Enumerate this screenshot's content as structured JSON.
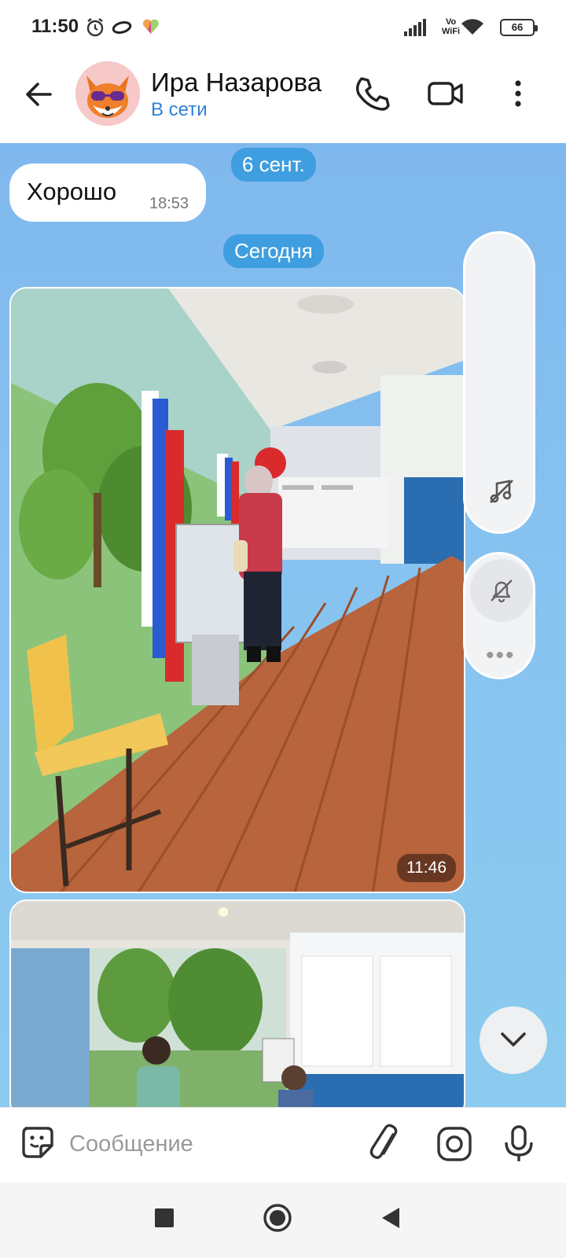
{
  "status_bar": {
    "time": "11:50",
    "volte_label": "Vo\nWiFi",
    "battery": "66",
    "icons": [
      "alarm-icon",
      "link-icon",
      "app-heart-icon",
      "signal-icon",
      "wifi-icon",
      "battery-icon"
    ]
  },
  "header": {
    "contact_name": "Ира Назарова",
    "presence": "В сети",
    "icons": [
      "back-arrow-icon",
      "phone-icon",
      "video-camera-icon",
      "more-vertical-icon"
    ]
  },
  "chat": {
    "date_separator_1": "6 сент.",
    "message_1": {
      "text": "Хорошо",
      "time": "18:53"
    },
    "date_separator_2": "Сегодня",
    "photo_1": {
      "time": "11:46",
      "description_icon": "photo"
    },
    "photo_2": {
      "time": ""
    },
    "side_panel_icons": [
      "music-off-icon",
      "bell-off-icon",
      "more-horizontal-icon"
    ],
    "dots_label": "•••"
  },
  "input": {
    "placeholder": "Сообщение",
    "icons": [
      "emoji-sticker-icon",
      "attach-paperclip-icon",
      "camera-icon",
      "microphone-icon"
    ]
  },
  "nav": {
    "icons": [
      "recent-apps-square-icon",
      "home-circle-icon",
      "back-triangle-icon"
    ]
  },
  "colors": {
    "accent": "#2f83d6",
    "date_pill": "#3f9ee0",
    "chat_bg_top": "#7fb8ee",
    "chat_bg_bottom": "#8ccbef"
  }
}
